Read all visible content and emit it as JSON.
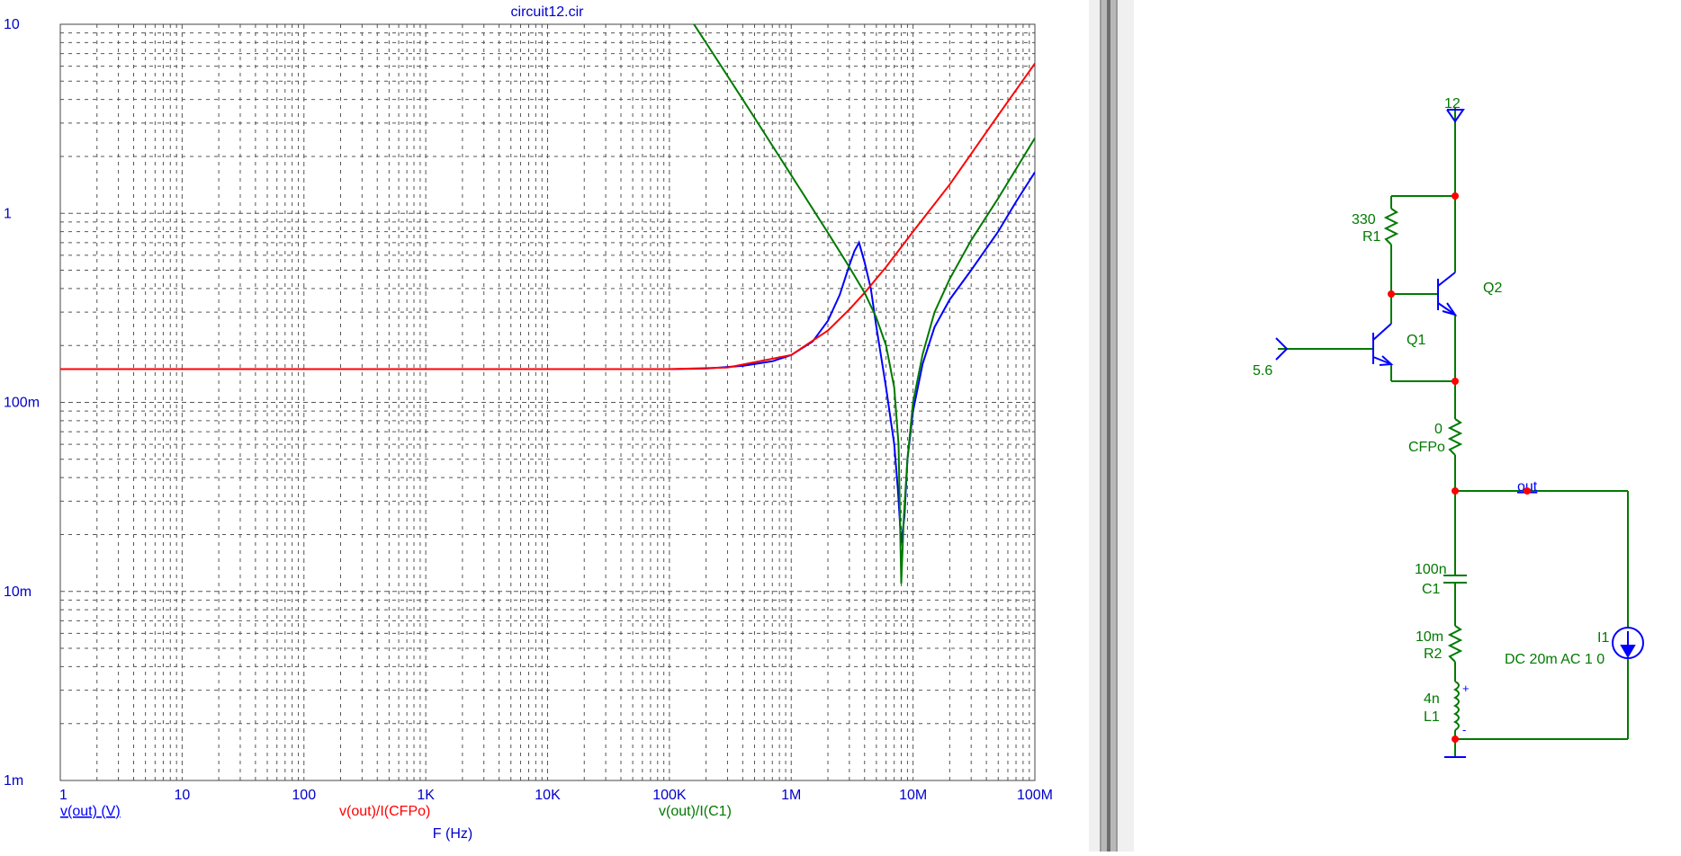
{
  "chart_data": {
    "type": "line",
    "title": "circuit12.cir",
    "xlabel": "F (Hz)",
    "x_scale": "log",
    "y_scale": "log",
    "xlim": [
      1,
      100000000
    ],
    "ylim": [
      0.001,
      10
    ],
    "x_tick_labels": [
      {
        "v": 1,
        "label": "1"
      },
      {
        "v": 10,
        "label": "10"
      },
      {
        "v": 100,
        "label": "100"
      },
      {
        "v": 1000,
        "label": "1K"
      },
      {
        "v": 10000,
        "label": "10K"
      },
      {
        "v": 100000,
        "label": "100K"
      },
      {
        "v": 1000000,
        "label": "1M"
      },
      {
        "v": 10000000,
        "label": "10M"
      },
      {
        "v": 100000000,
        "label": "100M"
      }
    ],
    "y_tick_labels": [
      {
        "v": 10,
        "label": "10"
      },
      {
        "v": 1,
        "label": "1"
      },
      {
        "v": 0.1,
        "label": "100m"
      },
      {
        "v": 0.01,
        "label": "10m"
      },
      {
        "v": 0.001,
        "label": "1m"
      }
    ],
    "grid": true,
    "series": [
      {
        "name": "v(out) (V)",
        "color": "#0000ff",
        "x": [
          1,
          100000,
          200000,
          400000,
          700000,
          1000000,
          1500000,
          2000000,
          2500000,
          3000000,
          3300000,
          3600000,
          4000000,
          4500000,
          5000000,
          6000000,
          7000000,
          7500000,
          8000000,
          8500000,
          9000000,
          10000000,
          12000000,
          15000000,
          20000000,
          30000000,
          50000000,
          70000000,
          100000000
        ],
        "y": [
          0.15,
          0.15,
          0.151,
          0.156,
          0.165,
          0.178,
          0.21,
          0.27,
          0.37,
          0.53,
          0.63,
          0.7,
          0.55,
          0.4,
          0.25,
          0.12,
          0.06,
          0.035,
          0.018,
          0.025,
          0.05,
          0.09,
          0.16,
          0.25,
          0.35,
          0.5,
          0.8,
          1.15,
          1.65
        ]
      },
      {
        "name": "v(out)/I(CFPo)",
        "color": "#ff0000",
        "x": [
          1,
          100000,
          300000,
          1000000,
          2000000,
          3000000,
          4000000,
          6000000,
          10000000,
          20000000,
          50000000,
          100000000
        ],
        "y": [
          0.15,
          0.15,
          0.153,
          0.178,
          0.24,
          0.31,
          0.38,
          0.52,
          0.8,
          1.42,
          3.3,
          6.2
        ]
      },
      {
        "name": "v(out)/I(C1)",
        "color": "#007a00",
        "x": [
          150000,
          250000,
          500000,
          1000000,
          2000000,
          3000000,
          4000000,
          5000000,
          6000000,
          7000000,
          7600000,
          8000000,
          8400000,
          9000000,
          10000000,
          12000000,
          15000000,
          20000000,
          30000000,
          50000000,
          100000000
        ],
        "y": [
          10.6,
          6.4,
          3.2,
          1.59,
          0.79,
          0.52,
          0.38,
          0.28,
          0.2,
          0.12,
          0.06,
          0.011,
          0.025,
          0.05,
          0.1,
          0.18,
          0.3,
          0.45,
          0.72,
          1.2,
          2.5
        ]
      }
    ]
  },
  "schematic": {
    "labels": {
      "vcc": "12",
      "r1_value": "330",
      "r1_name": "R1",
      "q1": "Q1",
      "q2": "Q2",
      "vin": "5.6",
      "cfpo_value": "0",
      "cfpo_name": "CFPo",
      "out": "out",
      "c1_value": "100n",
      "c1_name": "C1",
      "r2_value": "10m",
      "r2_name": "R2",
      "l1_value": "4n",
      "l1_name": "L1",
      "i1_name": "I1",
      "i1_value": "DC 20m AC 1 0",
      "plus": "+",
      "minus": "-"
    },
    "colors": {
      "wire": "#007a00",
      "device": "#0000ff",
      "node": "#ff0000",
      "label": "#007a00"
    }
  }
}
